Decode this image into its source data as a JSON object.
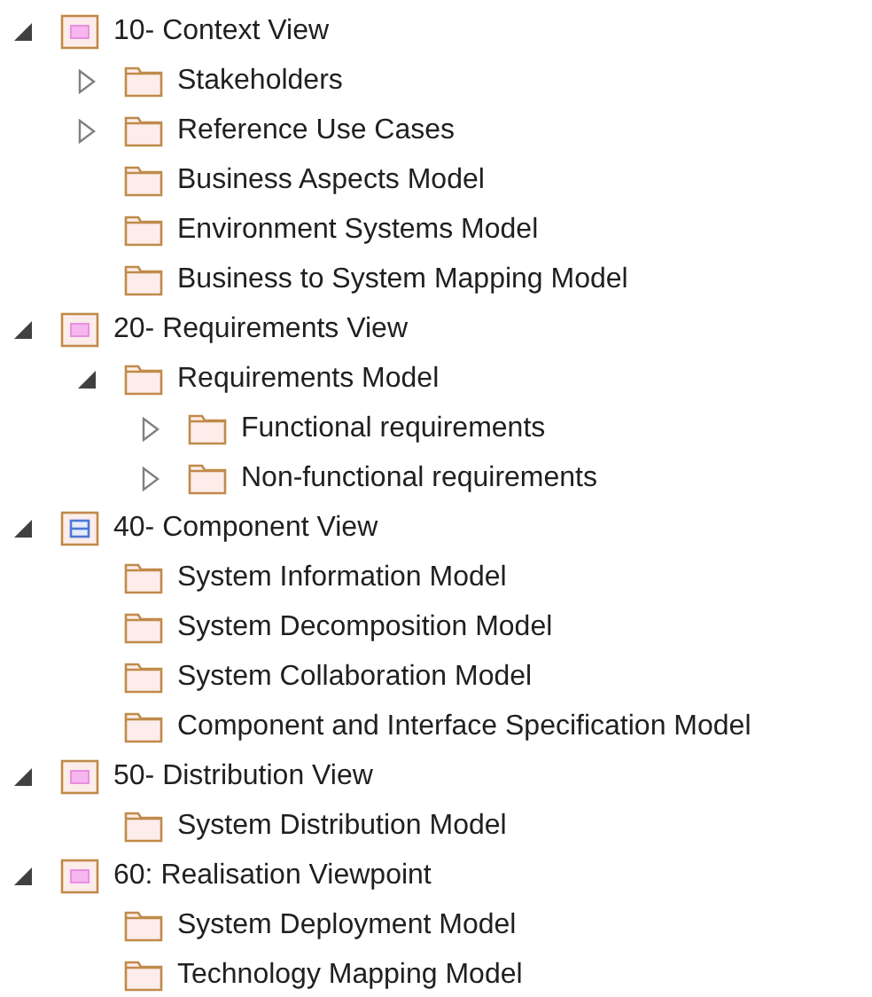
{
  "tree": [
    {
      "label": "10- Context View",
      "kind": "view",
      "expanded": true,
      "children": [
        {
          "label": "Stakeholders",
          "kind": "folder",
          "expanded": false
        },
        {
          "label": "Reference Use Cases",
          "kind": "folder",
          "expanded": false
        },
        {
          "label": "Business Aspects Model",
          "kind": "folder"
        },
        {
          "label": "Environment Systems Model",
          "kind": "folder"
        },
        {
          "label": "Business to System Mapping Model",
          "kind": "folder"
        }
      ]
    },
    {
      "label": "20- Requirements View",
      "kind": "view",
      "expanded": true,
      "children": [
        {
          "label": "Requirements Model",
          "kind": "folder",
          "expanded": true,
          "children": [
            {
              "label": "Functional requirements",
              "kind": "folder",
              "expanded": false
            },
            {
              "label": "Non-functional requirements",
              "kind": "folder",
              "expanded": false
            }
          ]
        }
      ]
    },
    {
      "label": "40- Component View",
      "kind": "component",
      "expanded": true,
      "children": [
        {
          "label": "System Information Model",
          "kind": "folder"
        },
        {
          "label": "System Decomposition Model",
          "kind": "folder"
        },
        {
          "label": "System Collaboration Model",
          "kind": "folder"
        },
        {
          "label": "Component and Interface Specification Model",
          "kind": "folder"
        }
      ]
    },
    {
      "label": "50- Distribution View",
      "kind": "view",
      "expanded": true,
      "children": [
        {
          "label": "System Distribution Model",
          "kind": "folder"
        }
      ]
    },
    {
      "label": "60: Realisation Viewpoint",
      "kind": "view",
      "expanded": true,
      "children": [
        {
          "label": "System Deployment Model",
          "kind": "folder"
        },
        {
          "label": "Technology Mapping Model",
          "kind": "folder"
        }
      ]
    }
  ]
}
